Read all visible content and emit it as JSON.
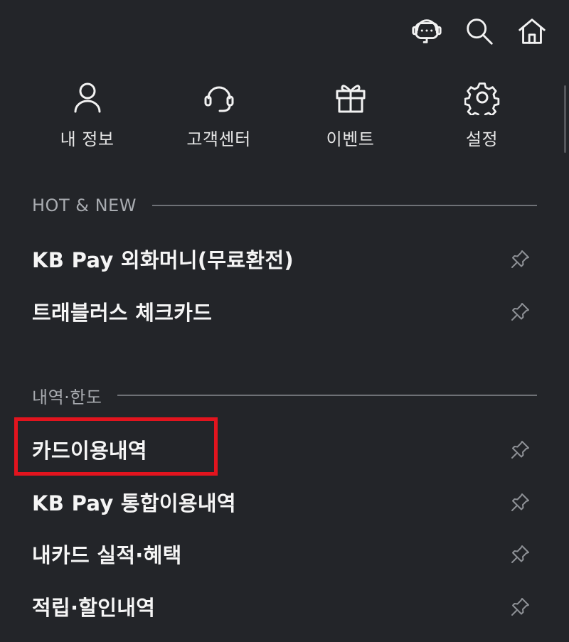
{
  "header": {
    "icons": [
      "chatbot-icon",
      "search-icon",
      "home-icon"
    ]
  },
  "quick_menu": [
    {
      "label": "내 정보",
      "icon": "person-icon"
    },
    {
      "label": "고객센터",
      "icon": "headset-icon"
    },
    {
      "label": "이벤트",
      "icon": "gift-icon"
    },
    {
      "label": "설정",
      "icon": "gear-icon"
    }
  ],
  "sections": [
    {
      "title": "HOT & NEW",
      "items": [
        {
          "label": "KB Pay 외화머니(무료환전)"
        },
        {
          "label": "트래블러스 체크카드"
        }
      ]
    },
    {
      "title": "내역·한도",
      "items": [
        {
          "label": "카드이용내역"
        },
        {
          "label": "KB Pay 통합이용내역"
        },
        {
          "label": "내카드 실적·혜택"
        },
        {
          "label": "적립·할인내역"
        }
      ]
    }
  ],
  "highlight": {
    "target": "카드이용내역",
    "color": "#e2141e"
  },
  "colors": {
    "background": "#232529",
    "text": "#f5f5f5",
    "muted": "#a8abb0",
    "divider": "#6e7176"
  }
}
